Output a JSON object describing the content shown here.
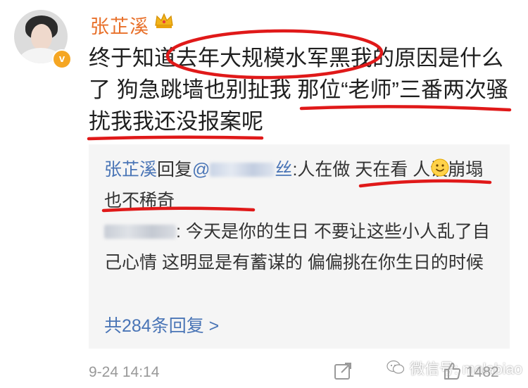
{
  "post": {
    "username": "张芷溪",
    "text": "终于知道去年大规模水军黑我的原因是什么了 狗急跳墙也别扯我 那位“老师”三番两次骚扰我我还没报案呢"
  },
  "replies": [
    {
      "author": "张芷溪",
      "verb": "回复",
      "mention_prefix": "@",
      "mention_tail": "丝",
      "separator": ":",
      "text": "人在做 天在看 人设崩塌也不稀奇"
    },
    {
      "separator": ": ",
      "text": "今天是你的生日  不要让这些小人乱了自己心情  这明显是有蓄谋的  偏偏挑在你生日的时候"
    }
  ],
  "more_replies": "共284条回复 >",
  "footer": {
    "date": "9-24 14:14",
    "watermark": "微信号: malabiao",
    "likes": "1482"
  },
  "colors": {
    "username": "#e8702a",
    "link": "#4a75b6",
    "annotation": "#e01919"
  },
  "icons": [
    "verified-badge-icon",
    "crown-icon",
    "smiley-emoji-icon",
    "share-icon",
    "wechat-logo-icon",
    "like-icon"
  ]
}
